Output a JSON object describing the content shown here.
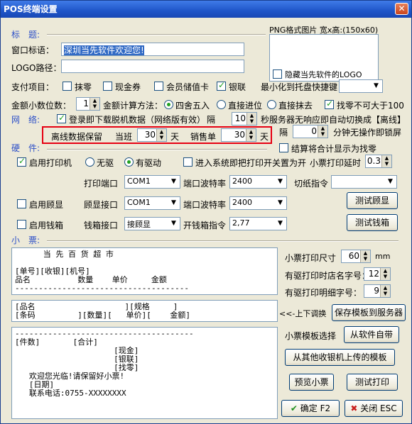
{
  "window": {
    "title": "POS终端设置",
    "close_glyph": "✕"
  },
  "sections": {
    "title": "标　题:",
    "network": "网　络:",
    "hardware": "硬　件:",
    "receipt": "小　票:"
  },
  "labels": {
    "window_title": "窗口标语：",
    "logo_path": "LOGO路径：",
    "png_hint": "PNG格式图片 宽x高:(150x60)",
    "hide_logo": "隐藏当先软件的LOGO",
    "payment_items": "支付项目：",
    "pay_wipe": "抹零",
    "pay_coupon": "现金券",
    "pay_member": "会员储值卡",
    "pay_unionpay": "银联",
    "minimize": "最小化到托盘快捷键",
    "decimal_places": "金额小数位数：",
    "calc_method": "金额计算方法：",
    "calc_round": "四舍五入",
    "calc_up": "直接进位",
    "calc_wipe": "直接抹去",
    "change_limit": "找零不可大于100",
    "download_offline": "登录即下载脱机数据（网络版有效）",
    "interval": "隔",
    "seconds_switch": "秒服务器无响应即自动切换成【离线】",
    "offline_keep": "离线数据保留",
    "current_shift": "当班",
    "days1": "天",
    "sales_bill": "销售单",
    "days2": "天",
    "interval2": "隔",
    "minutes_lock": "分钟无操作即锁屏",
    "settle_change": "结算将合计显示为找零",
    "enable_printer": "启用打印机",
    "no_driver": "无驱",
    "has_driver": "有驱动",
    "print_on_enter": "进入系统即把打印开关置为开",
    "print_delay": "小票打印延时",
    "print_port": "打印端口",
    "baud_rate": "端口波特率",
    "cut_cmd": "切纸指令",
    "enable_display": "启用顾显",
    "display_port": "顾显接口",
    "baud_rate2": "端口波特率",
    "enable_drawer": "启用钱箱",
    "drawer_port": "钱箱接口",
    "drawer_cmd": "开钱箱指令",
    "paper_size": "小票打印尺寸",
    "mm": "mm",
    "header_font": "有驱打印时店名字号：",
    "detail_font": "有驱打印明细字号：",
    "swap": "<<-上下调换",
    "template_select": "小票模板选择"
  },
  "inputs": {
    "window_title": "深圳当先软件欢迎您!",
    "logo_path": ""
  },
  "values": {
    "decimal_places": "1",
    "interval_seconds": "10",
    "current_shift_days": "30",
    "sales_bill_days": "30",
    "lock_minutes": "0",
    "print_delay": "0.3",
    "print_port": "COM1",
    "baud_rate": "2400",
    "cut_cmd": "",
    "display_port": "COM1",
    "baud_rate2": "2400",
    "drawer_port": "接顾显",
    "drawer_cmd": "2,77",
    "paper_size": "60",
    "header_font": "12",
    "detail_font": "9",
    "minimize_key": ""
  },
  "checks": {
    "hide_logo": false,
    "pay_wipe": false,
    "pay_coupon": false,
    "pay_member": false,
    "pay_unionpay": true,
    "change_limit": true,
    "download_offline": true,
    "settle_change": false,
    "enable_printer": true,
    "print_on_enter": false,
    "enable_display": false,
    "enable_drawer": false
  },
  "radios": {
    "calc_method": "四舍五入",
    "driver": "有驱动"
  },
  "receipt": {
    "header": "      当 先 百 货 超 市\n\n[单号][收银][机号]\n品名          数量    单价     金额\n-------------------------------------",
    "detail": "[品名                   ][规格     ]\n[条码         ][数量][   单价][    金额]\n",
    "footer": "--------------------------------------\n[件数]       [合计]\n                     [现金]\n                     [银联]\n                     [找零]\n   欢迎您光临!请保留好小票!\n   [日期]\n   联系电话:0755-XXXXXXXX"
  },
  "buttons": {
    "test_display": "测试顾显",
    "test_drawer": "测试钱箱",
    "save_template": "保存模板到服务器",
    "from_software": "从软件自带",
    "from_other": "从其他收银机上传的模板",
    "preview": "预览小票",
    "test_print": "测试打印",
    "ok": "确定 F2",
    "close": "关闭 ESC"
  }
}
